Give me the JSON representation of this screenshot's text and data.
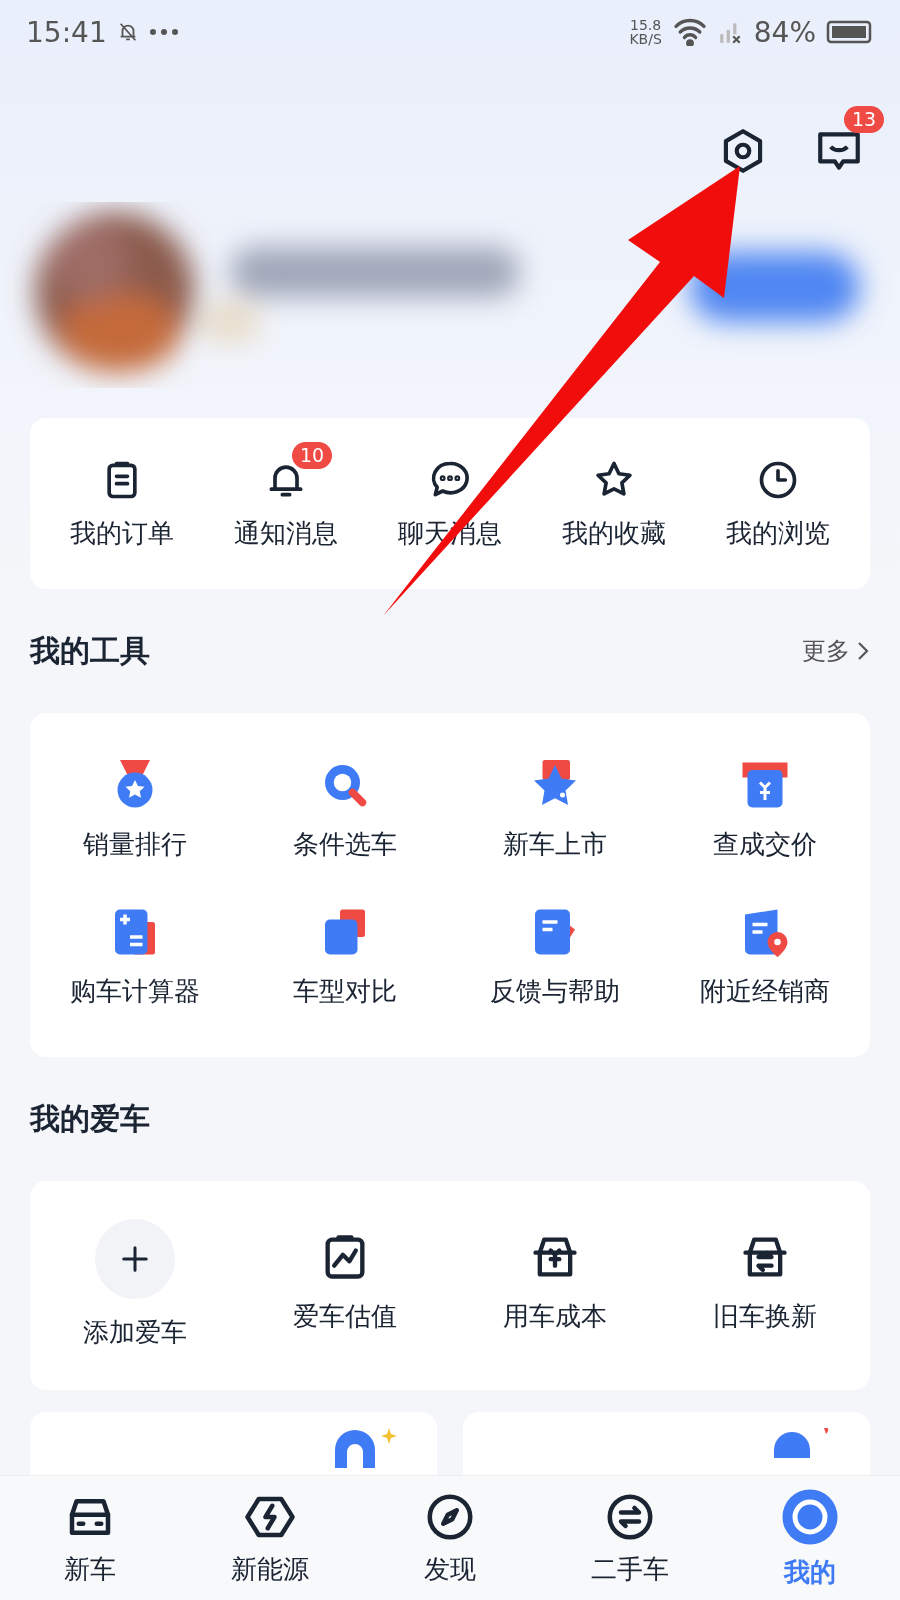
{
  "status_bar": {
    "time": "15:41",
    "speed": "15.8",
    "speed_unit": "KB/S",
    "battery": "84%"
  },
  "header": {
    "messages_badge": "13"
  },
  "quick_links": [
    {
      "label": "我的订单",
      "kind": "order"
    },
    {
      "label": "通知消息",
      "kind": "bell",
      "badge": "10"
    },
    {
      "label": "聊天消息",
      "kind": "chat"
    },
    {
      "label": "我的收藏",
      "kind": "star"
    },
    {
      "label": "我的浏览",
      "kind": "clock"
    }
  ],
  "tools": {
    "title": "我的工具",
    "more": "更多",
    "items": [
      {
        "label": "销量排行",
        "kind": "medal"
      },
      {
        "label": "条件选车",
        "kind": "search"
      },
      {
        "label": "新车上市",
        "kind": "newstar"
      },
      {
        "label": "查成交价",
        "kind": "price"
      },
      {
        "label": "购车计算器",
        "kind": "calc"
      },
      {
        "label": "车型对比",
        "kind": "compare"
      },
      {
        "label": "反馈与帮助",
        "kind": "feedback"
      },
      {
        "label": "附近经销商",
        "kind": "dealer"
      }
    ]
  },
  "my_car": {
    "title": "我的爱车",
    "items": [
      {
        "label": "添加爱车",
        "kind": "add"
      },
      {
        "label": "爱车估值",
        "kind": "chart"
      },
      {
        "label": "用车成本",
        "kind": "yen"
      },
      {
        "label": "旧车换新",
        "kind": "swapcar"
      }
    ]
  },
  "nav": [
    {
      "label": "新车",
      "kind": "car",
      "selected": false
    },
    {
      "label": "新能源",
      "kind": "bolt",
      "selected": false
    },
    {
      "label": "发现",
      "kind": "compass",
      "selected": false
    },
    {
      "label": "二手车",
      "kind": "exchange",
      "selected": false
    },
    {
      "label": "我的",
      "kind": "me",
      "selected": true
    }
  ]
}
